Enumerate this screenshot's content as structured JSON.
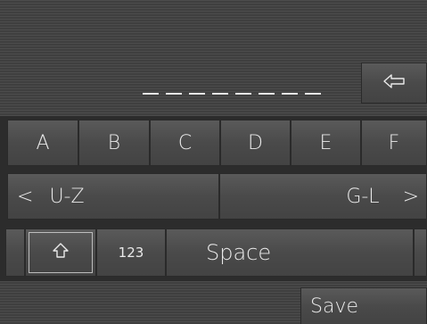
{
  "input": {
    "placeholder_slots": 8,
    "backspace_icon": "backspace-arrow-icon"
  },
  "letters": [
    "A",
    "B",
    "C",
    "D",
    "E",
    "F"
  ],
  "nav": {
    "prev_arrow": "<",
    "prev_label": "U-Z",
    "next_label": "G-L",
    "next_arrow": ">"
  },
  "bottom_row": {
    "shift_icon": "shift-arrow-icon",
    "numbers_label": "123",
    "space_label": "Space"
  },
  "footer": {
    "save_label": "Save"
  }
}
